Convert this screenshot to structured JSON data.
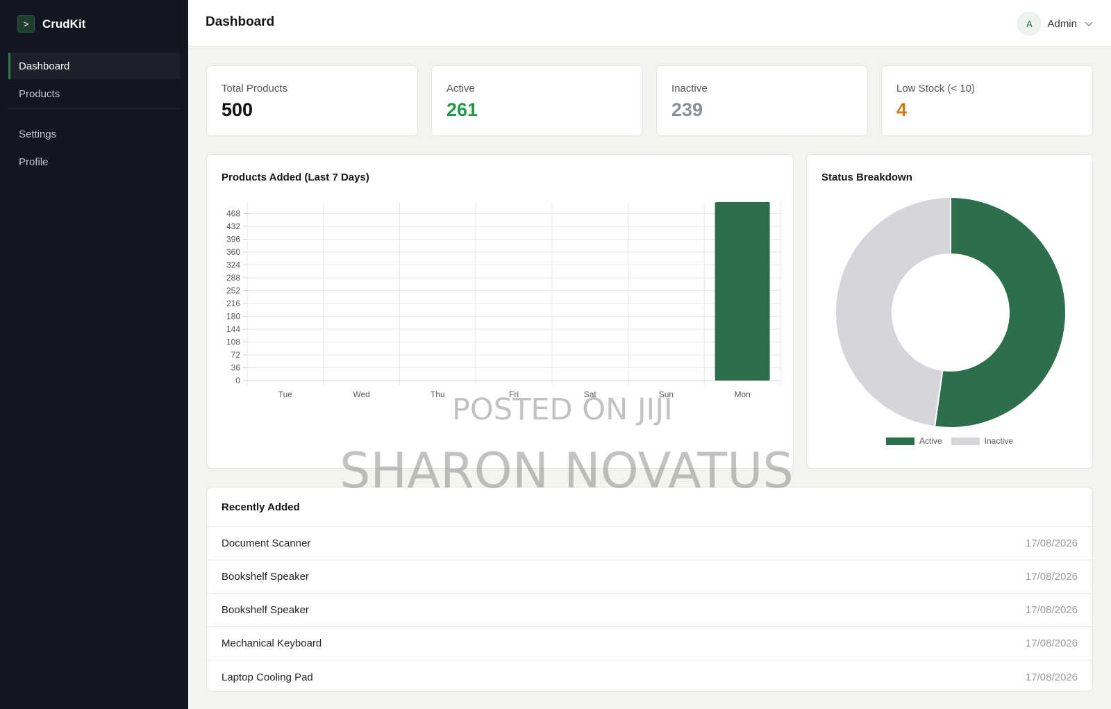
{
  "app": {
    "brand_mark": ">",
    "brand_name": "CrudKit"
  },
  "sidebar": {
    "items": [
      {
        "label": "Dashboard",
        "active": true
      },
      {
        "label": "Products",
        "active": false
      },
      {
        "label": "Settings",
        "active": false
      },
      {
        "label": "Profile",
        "active": false
      }
    ]
  },
  "header": {
    "title": "Dashboard",
    "user_initial": "A",
    "user_name": "Admin"
  },
  "stats": [
    {
      "label": "Total Products",
      "value": "500",
      "color": "#111111"
    },
    {
      "label": "Active",
      "value": "261",
      "color": "#1f9a4a"
    },
    {
      "label": "Inactive",
      "value": "239",
      "color": "#8a8f96"
    },
    {
      "label": "Low Stock (< 10)",
      "value": "4",
      "color": "#d07a12"
    }
  ],
  "bar_chart": {
    "title": "Products Added (Last 7 Days)"
  },
  "donut_chart": {
    "title": "Status Breakdown"
  },
  "chart_data": [
    {
      "type": "bar",
      "title": "Products Added (Last 7 Days)",
      "categories": [
        "Tue",
        "Wed",
        "Thu",
        "Fri",
        "Sat",
        "Sun",
        "Mon"
      ],
      "values": [
        0,
        0,
        0,
        0,
        0,
        0,
        500
      ],
      "yticks": [
        0,
        36,
        72,
        108,
        144,
        180,
        216,
        252,
        288,
        324,
        360,
        396,
        432,
        468
      ],
      "ylim": [
        0,
        500
      ],
      "grid": true,
      "color": "#2e6e4b"
    },
    {
      "type": "pie",
      "title": "Status Breakdown",
      "donut": true,
      "labels": [
        "Active",
        "Inactive"
      ],
      "values": [
        261,
        239
      ],
      "colors": [
        "#2e6e4b",
        "#d4d6db"
      ],
      "legend": "bottom"
    }
  ],
  "recent": {
    "title": "Recently Added",
    "rows": [
      {
        "name": "Document Scanner",
        "date": "17/08/2026"
      },
      {
        "name": "Bookshelf Speaker",
        "date": "17/08/2026"
      },
      {
        "name": "Bookshelf Speaker",
        "date": "17/08/2026"
      },
      {
        "name": "Mechanical Keyboard",
        "date": "17/08/2026"
      },
      {
        "name": "Laptop Cooling Pad",
        "date": "17/08/2026"
      }
    ]
  },
  "watermark": {
    "line1": "POSTED ON JIJI",
    "line2": "SHARON NOVATUS"
  }
}
